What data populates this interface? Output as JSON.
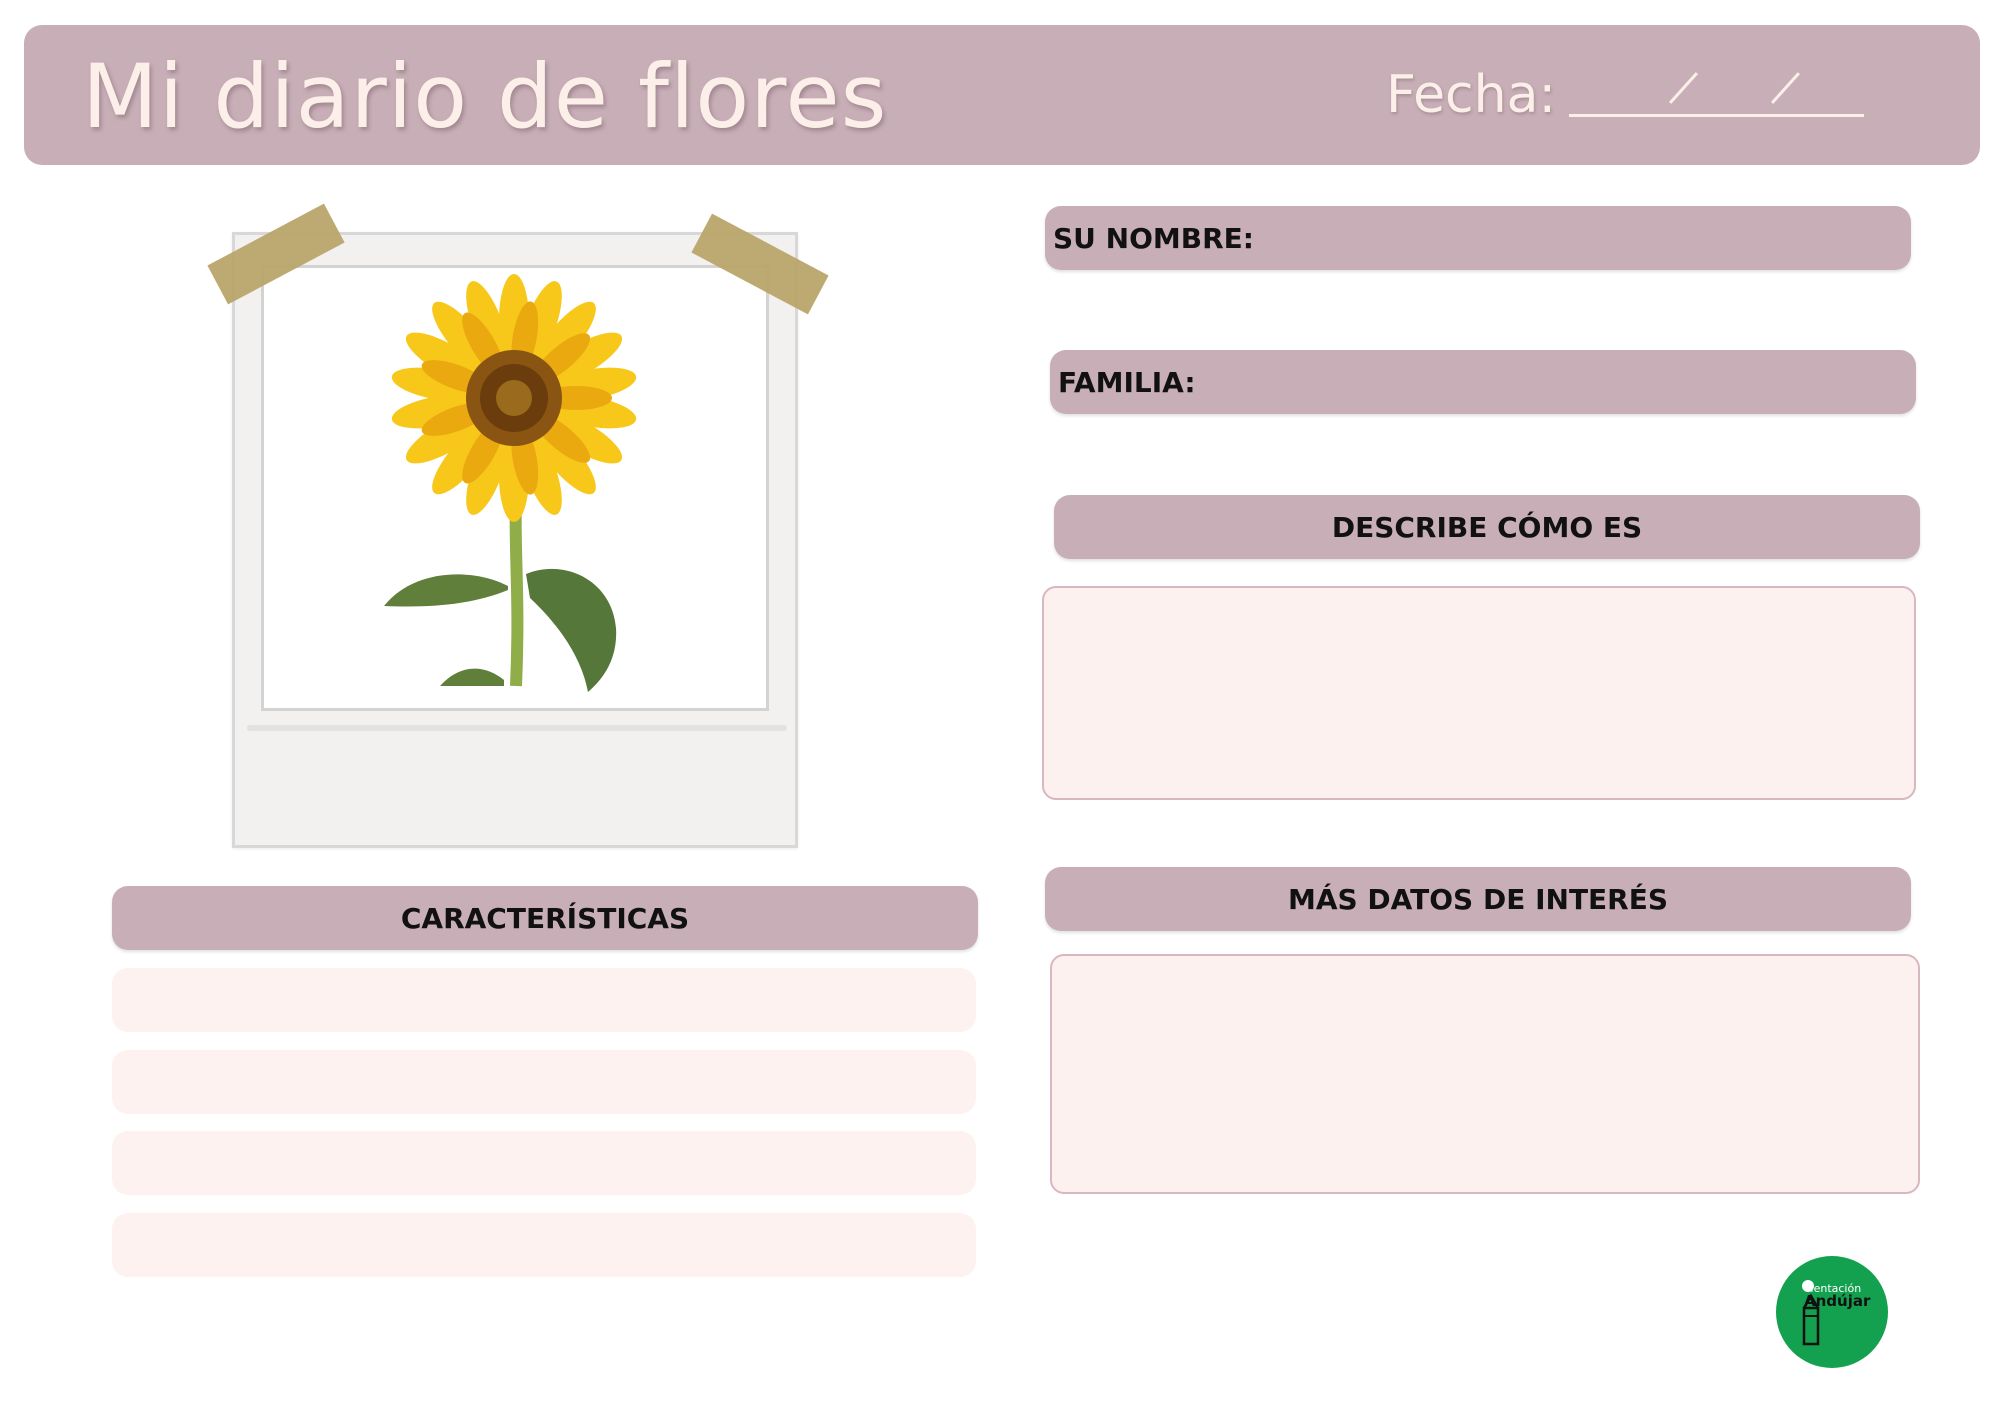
{
  "header": {
    "title": "Mi diario de flores",
    "fecha_label": "Fecha:"
  },
  "photo": {
    "subject": "sunflower-image"
  },
  "fields": {
    "nombre_label": "SU NOMBRE:",
    "familia_label": "FAMILIA:",
    "describe_label": "DESCRIBE CÓMO ES",
    "mas_datos_label": "MÁS DATOS DE INTERÉS",
    "caracteristicas_label": "CARACTERÍSTICAS"
  },
  "caracteristicas_lines": [
    "",
    "",
    "",
    ""
  ],
  "logo": {
    "line1": "rientación",
    "line2": "Andújar"
  },
  "colors": {
    "header_bg": "#c8afb7",
    "box_bg": "#fdf1ef",
    "logo_green": "#13a04f"
  }
}
